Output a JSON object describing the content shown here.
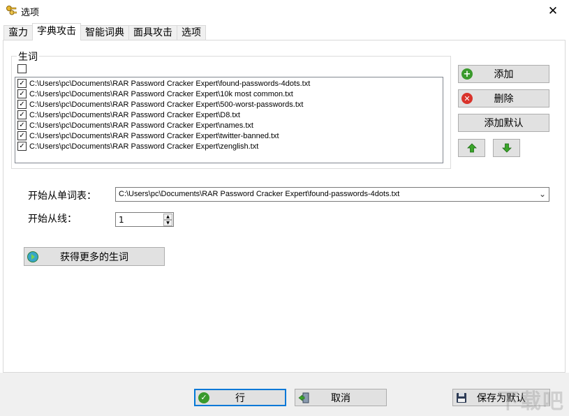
{
  "window": {
    "title": "选项",
    "close_glyph": "✕"
  },
  "tabs": [
    {
      "label": "蛮力"
    },
    {
      "label": "字典攻击"
    },
    {
      "label": "智能词典"
    },
    {
      "label": "面具攻击"
    },
    {
      "label": "选项"
    }
  ],
  "active_tab": 1,
  "wordlists": {
    "group_label": "生词",
    "items": [
      {
        "path": "C:\\Users\\pc\\Documents\\RAR Password Cracker Expert\\found-passwords-4dots.txt",
        "checked": true
      },
      {
        "path": "C:\\Users\\pc\\Documents\\RAR Password Cracker Expert\\10k most common.txt",
        "checked": true
      },
      {
        "path": "C:\\Users\\pc\\Documents\\RAR Password Cracker Expert\\500-worst-passwords.txt",
        "checked": true
      },
      {
        "path": "C:\\Users\\pc\\Documents\\RAR Password Cracker Expert\\D8.txt",
        "checked": true
      },
      {
        "path": "C:\\Users\\pc\\Documents\\RAR Password Cracker Expert\\names.txt",
        "checked": true
      },
      {
        "path": "C:\\Users\\pc\\Documents\\RAR Password Cracker Expert\\twitter-banned.txt",
        "checked": true
      },
      {
        "path": "C:\\Users\\pc\\Documents\\RAR Password Cracker Expert\\zenglish.txt",
        "checked": true
      }
    ],
    "add_label": "添加",
    "delete_label": "删除",
    "add_default_label": "添加默认"
  },
  "start_wordlist": {
    "label": "开始从单词表：",
    "value": "C:\\Users\\pc\\Documents\\RAR Password Cracker Expert\\found-passwords-4dots.txt"
  },
  "start_line": {
    "label": "开始从线：",
    "value": "1"
  },
  "get_more_label": "获得更多的生词",
  "footer": {
    "ok_label": "行",
    "cancel_label": "取消",
    "save_default_label": "保存为默认"
  },
  "watermark": "下载吧",
  "colors": {
    "add_icon": "#3a9a2c",
    "delete_icon": "#d9332b",
    "arrow_green": "#3aa52a",
    "ok_border": "#0078d7"
  }
}
